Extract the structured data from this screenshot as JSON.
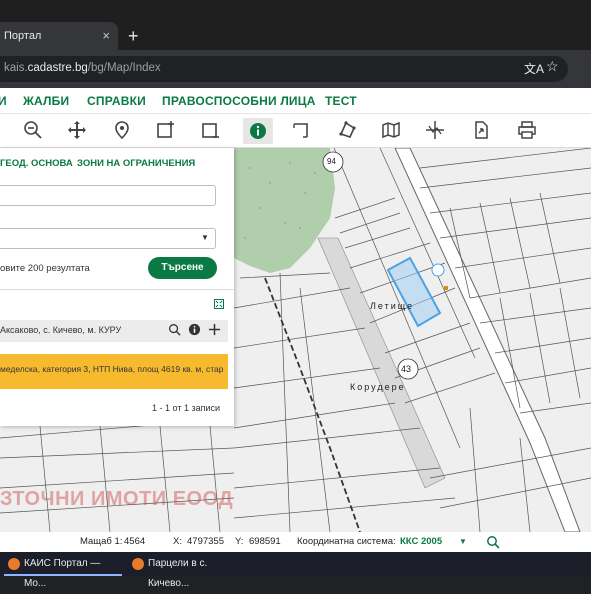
{
  "browser": {
    "tab_title": "Портал",
    "tab_close": "×",
    "new_tab": "+",
    "url_prefix": "kais.",
    "url_domain": "cadastre.bg",
    "url_path": "/bg/Map/Index"
  },
  "menu": {
    "items": [
      "И",
      "ЖАЛБИ",
      "СПРАВКИ",
      "ПРАВОСПОСОБНИ ЛИЦА",
      "ТЕСТ"
    ]
  },
  "panel": {
    "tabs": [
      "ГЕОД. ОСНОВА",
      "ЗОНИ НА ОГРАНИЧЕНИЯ"
    ],
    "note": "овите 200 резултата",
    "search_button": "Търсене",
    "result_text": "Аксаково, с. Кичево, м. КУРУ",
    "yellow_text": "меделска, категория 3, НТП Нива, площ 4619 кв. м, стар",
    "pager": "1 - 1 от 1 записи"
  },
  "map": {
    "labels": {
      "letishte": "Летище",
      "koruderе": "Корудере",
      "num_43": "43",
      "num_94": "94"
    },
    "watermark": "ЗТОЧНИ ИМОТИ ЕООД"
  },
  "statusbar": {
    "scale_label": "Мащаб 1:",
    "scale_value": "4564",
    "x_label": "X:",
    "x_value": "4797355",
    "y_label": "Y:",
    "y_value": "698591",
    "crs_label": "Координатна система:",
    "crs_value": "ККС 2005"
  },
  "taskbar": {
    "items": [
      "КАИС Портал — Mo...",
      "Парцели в с. Кичево..."
    ]
  },
  "colors": {
    "brand_green": "#0a7a45",
    "parcel_highlight": "#4aa3e8",
    "result_yellow": "#f7ba2e"
  }
}
